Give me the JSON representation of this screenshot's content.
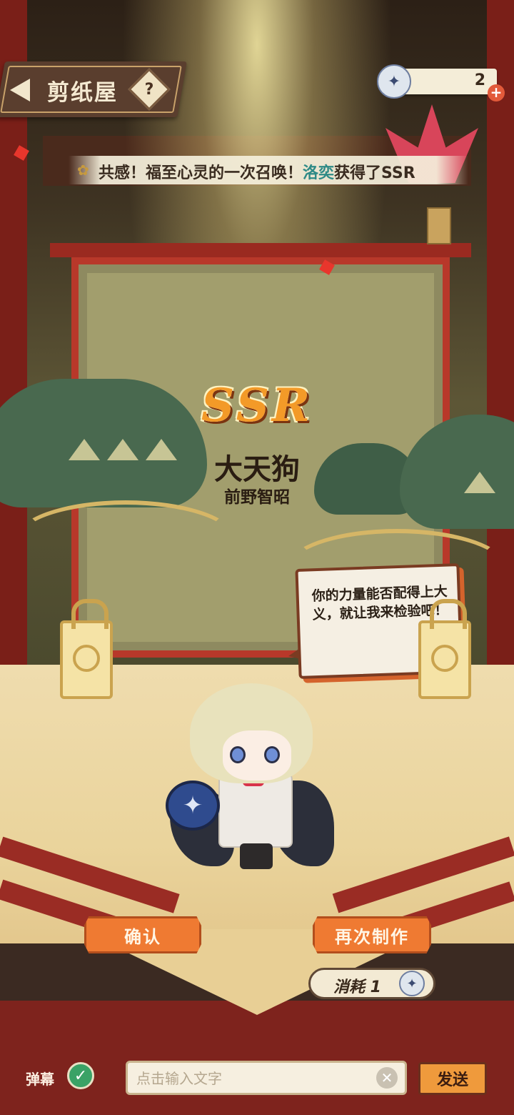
{
  "header": {
    "title": "剪纸屋",
    "help_label": "?",
    "ticket_count": "2",
    "add_label": "+"
  },
  "ticker": {
    "prefix": "共感！福至心灵的一次召唤！",
    "player_name": "洛奕",
    "suffix": "获得了SSR"
  },
  "result": {
    "rarity": "SSR",
    "character_name": "大天狗",
    "voice_actor": "前野智昭",
    "quote": "你的力量能否配得上大义，就让我来检验吧！"
  },
  "actions": {
    "confirm_label": "确认",
    "again_label": "再次制作",
    "cost_label": "消耗 1"
  },
  "chat": {
    "danmu_label": "弹幕",
    "input_placeholder": "点击输入文字",
    "send_label": "发送"
  },
  "colors": {
    "accent_orange": "#ef7a32",
    "frame_red": "#b8382a",
    "player_name": "#2e8a86"
  }
}
